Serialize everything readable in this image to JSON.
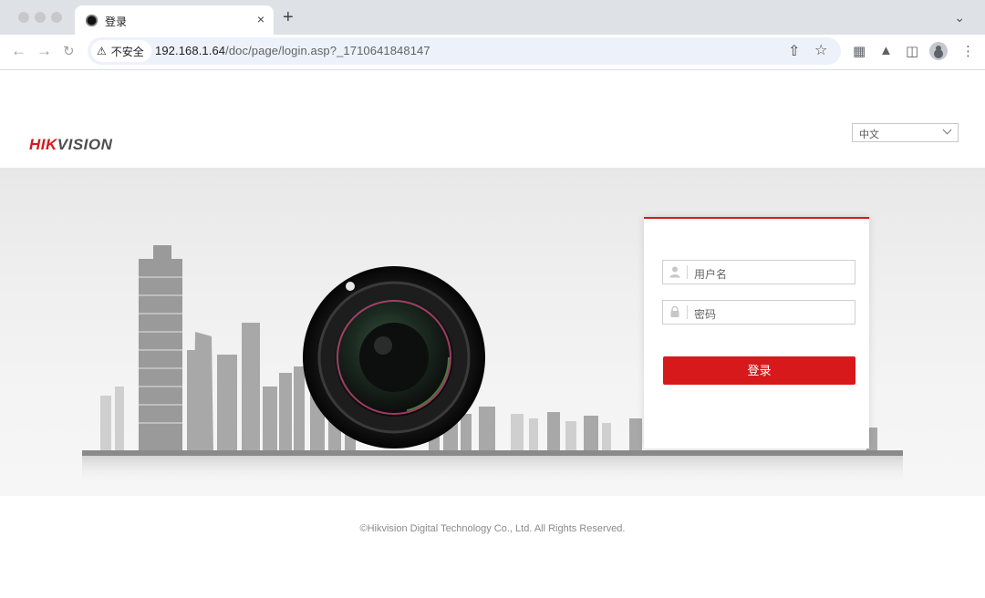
{
  "browser": {
    "tab_title": "登录",
    "tab_close": "×",
    "new_tab": "+",
    "security_label": "不安全",
    "url_host": "192.168.1.64",
    "url_path": "/doc/page/login.asp?_1710641848147"
  },
  "header": {
    "logo_hik": "HIK",
    "logo_vision": "VISION",
    "language_selected": "中文"
  },
  "login": {
    "username_placeholder": "用户名",
    "password_placeholder": "密码",
    "submit_label": "登录"
  },
  "footer": {
    "copyright": "©Hikvision Digital Technology Co., Ltd. All Rights Reserved."
  },
  "colors": {
    "brand_red": "#d7191c",
    "logo_gray": "#4d4d4d"
  }
}
